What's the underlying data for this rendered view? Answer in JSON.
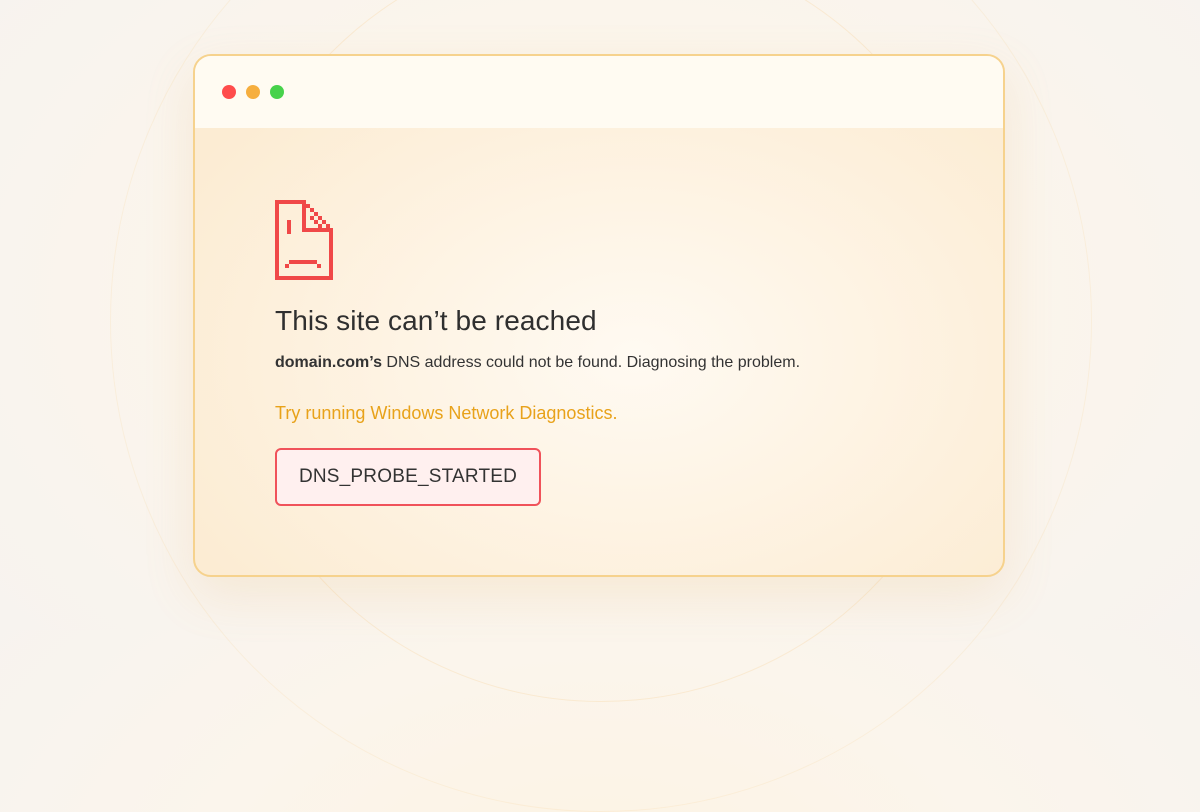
{
  "window": {
    "controls": [
      {
        "name": "close",
        "color": "#ff4c4c"
      },
      {
        "name": "minimize",
        "color": "#f6ae3e"
      },
      {
        "name": "maximize",
        "color": "#47d24b"
      }
    ]
  },
  "error": {
    "icon": "sad-document-icon",
    "icon_color": "#f04848",
    "title": "This site can’t be reached",
    "domain": "domain.com’s",
    "message": " DNS address could not be found. Diagnosing the problem.",
    "diagnostics_link": "Try running Windows Network Diagnostics.",
    "link_color": "#e8a21a",
    "code": "DNS_PROBE_STARTED"
  }
}
